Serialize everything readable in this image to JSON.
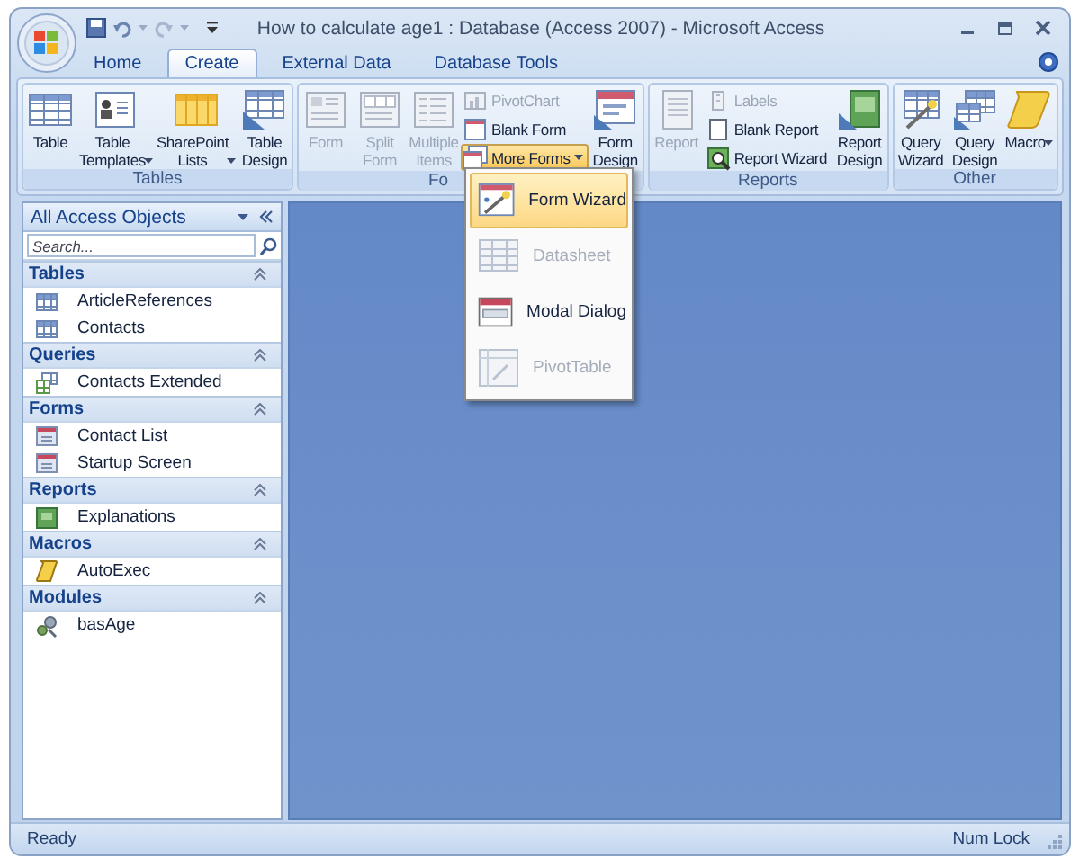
{
  "window": {
    "title": "How to calculate age1 : Database (Access 2007) - Microsoft Access"
  },
  "tabs": [
    {
      "label": "Home",
      "selected": false
    },
    {
      "label": "Create",
      "selected": true
    },
    {
      "label": "External Data",
      "selected": false
    },
    {
      "label": "Database Tools",
      "selected": false
    }
  ],
  "ribbon_groups": [
    {
      "label": "Tables",
      "controls": [
        {
          "kind": "large",
          "label": "Table",
          "disabled": false,
          "dropdown": false
        },
        {
          "kind": "large",
          "label": "Table Templates",
          "disabled": false,
          "dropdown": true
        },
        {
          "kind": "large",
          "label": "SharePoint Lists",
          "disabled": false,
          "dropdown": true
        },
        {
          "kind": "large",
          "label": "Table Design",
          "disabled": false,
          "dropdown": false
        }
      ]
    },
    {
      "label": "Fo",
      "controls": [
        {
          "kind": "large",
          "label": "Form",
          "disabled": true,
          "dropdown": false
        },
        {
          "kind": "large",
          "label": "Split Form",
          "disabled": true,
          "dropdown": false
        },
        {
          "kind": "large",
          "label": "Multiple Items",
          "disabled": true,
          "dropdown": false
        },
        {
          "kind": "small_stack",
          "items": [
            {
              "label": "PivotChart",
              "disabled": true,
              "dropdown": false,
              "pressed": false
            },
            {
              "label": "Blank Form",
              "disabled": false,
              "dropdown": false,
              "pressed": false
            },
            {
              "label": "More Forms",
              "disabled": false,
              "dropdown": true,
              "pressed": true
            }
          ]
        },
        {
          "kind": "large",
          "label": "Form Design",
          "disabled": false,
          "dropdown": false
        }
      ]
    },
    {
      "label": "Reports",
      "controls": [
        {
          "kind": "large",
          "label": "Report",
          "disabled": true,
          "dropdown": false
        },
        {
          "kind": "small_stack",
          "items": [
            {
              "label": "Labels",
              "disabled": true,
              "dropdown": false,
              "pressed": false
            },
            {
              "label": "Blank Report",
              "disabled": false,
              "dropdown": false,
              "pressed": false
            },
            {
              "label": "Report Wizard",
              "disabled": false,
              "dropdown": false,
              "pressed": false
            }
          ]
        },
        {
          "kind": "large",
          "label": "Report Design",
          "disabled": false,
          "dropdown": false
        }
      ]
    },
    {
      "label": "Other",
      "controls": [
        {
          "kind": "large",
          "label": "Query Wizard",
          "disabled": false,
          "dropdown": false
        },
        {
          "kind": "large",
          "label": "Query Design",
          "disabled": false,
          "dropdown": false
        },
        {
          "kind": "large",
          "label": "Macro",
          "disabled": false,
          "dropdown": true
        }
      ]
    }
  ],
  "more_forms_menu": [
    {
      "label": "Form Wizard",
      "selected": true,
      "disabled": false
    },
    {
      "label": "Datasheet",
      "selected": false,
      "disabled": true
    },
    {
      "label": "Modal Dialog",
      "selected": false,
      "disabled": false
    },
    {
      "label": "PivotTable",
      "selected": false,
      "disabled": true
    }
  ],
  "navigation_pane": {
    "title": "All Access Objects",
    "search": {
      "placeholder": "Search..."
    },
    "groups": [
      {
        "label": "Tables",
        "kind": "table",
        "items": [
          "ArticleReferences",
          "Contacts"
        ]
      },
      {
        "label": "Queries",
        "kind": "query",
        "items": [
          "Contacts Extended"
        ]
      },
      {
        "label": "Forms",
        "kind": "form",
        "items": [
          "Contact List",
          "Startup Screen"
        ]
      },
      {
        "label": "Reports",
        "kind": "report",
        "items": [
          "Explanations"
        ]
      },
      {
        "label": "Macros",
        "kind": "macro",
        "items": [
          "AutoExec"
        ]
      },
      {
        "label": "Modules",
        "kind": "module",
        "items": [
          "basAge"
        ]
      }
    ]
  },
  "status_bar": {
    "left": "Ready",
    "right": "Num Lock"
  }
}
